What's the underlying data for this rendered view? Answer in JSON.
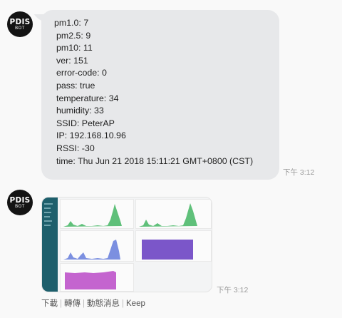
{
  "bot": {
    "avatar_text": "PDIS",
    "avatar_subtext": "BOT"
  },
  "message1": {
    "lines": [
      "pm1.0: 7",
      "pm2.5: 9",
      "pm10: 11",
      "ver: 151",
      "error-code: 0",
      "pass: true",
      "temperature: 34",
      "humidity: 33",
      "SSID: PeterAP",
      "IP: 192.168.10.96",
      "RSSI: -30",
      "time: Thu Jun 21 2018 15:11:21 GMT+0800 (CST)"
    ],
    "timestamp": "下午 3:12"
  },
  "message2": {
    "timestamp": "下午 3:12",
    "panel_colors": [
      "#5fc07a",
      "#5fc07a",
      "#7b8fe0",
      "#7b56c9",
      "#c464cf"
    ]
  },
  "actions": {
    "download": "下載",
    "forward": "轉傳",
    "timeline": "動態消息",
    "keep": "Keep"
  }
}
